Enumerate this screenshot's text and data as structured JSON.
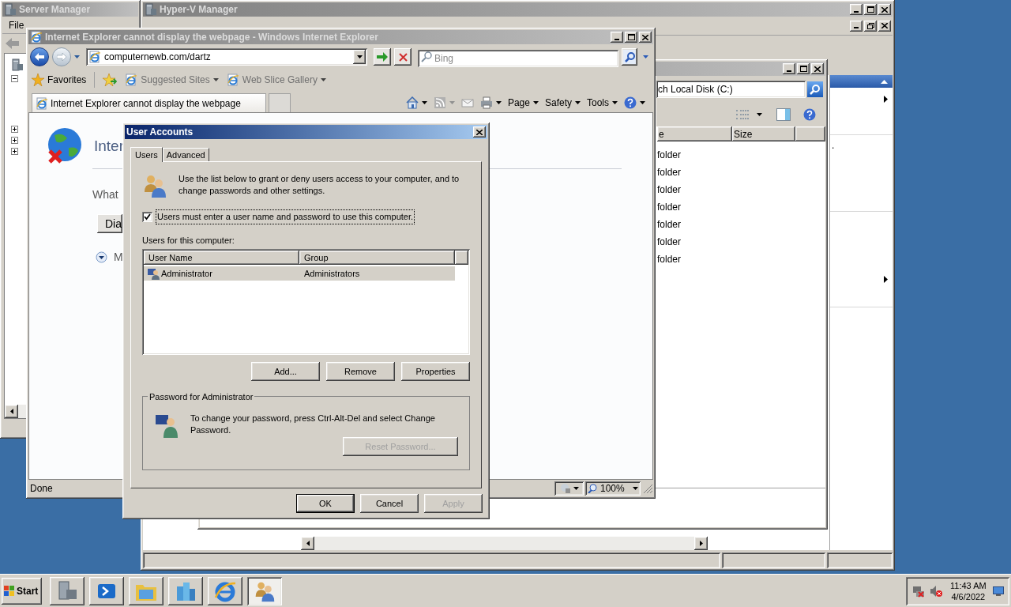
{
  "server_manager": {
    "title": "Server Manager",
    "active": false,
    "menu": [
      "File"
    ],
    "tree": [
      {
        "expanded": true
      },
      {
        "expanded": false
      },
      {
        "expanded": false
      },
      {
        "expanded": false
      }
    ]
  },
  "hyperv": {
    "title": "Hyper-V Manager",
    "active": false,
    "action_text": "."
  },
  "explorer": {
    "active": false,
    "search_text": "ch Local Disk (C:)",
    "columns": [
      "e",
      "Size"
    ],
    "rows": [
      "folder",
      "folder",
      "folder",
      "folder",
      "folder",
      "folder",
      "folder"
    ]
  },
  "ie": {
    "title": "Internet Explorer cannot display the webpage - Windows Internet Explorer",
    "active": false,
    "address": "computernewb.com/dartz",
    "search_placeholder": "Bing",
    "favorites": "Favorites",
    "links": [
      "Suggested Sites",
      "Web Slice Gallery"
    ],
    "tab": "Internet Explorer cannot display the webpage",
    "commands": [
      "Page",
      "Safety",
      "Tools"
    ],
    "page": {
      "heading": "Inter",
      "question": "What",
      "button": "Dia",
      "more": "M"
    },
    "status": "Done",
    "zoom": "100%"
  },
  "dialog": {
    "title": "User Accounts",
    "active": true,
    "tabs": [
      {
        "label": "Users",
        "selected": true
      },
      {
        "label": "Advanced",
        "selected": false
      }
    ],
    "intro": "Use the list below to grant or deny users access to your computer, and to change passwords and other settings.",
    "checkbox": {
      "label": "Users must enter a user name and password to use this computer.",
      "checked": true
    },
    "list_label": "Users for this computer:",
    "columns": [
      "User Name",
      "Group"
    ],
    "users": [
      {
        "name": "Administrator",
        "group": "Administrators",
        "selected": true
      }
    ],
    "buttons": [
      {
        "label": "Add...",
        "disabled": false
      },
      {
        "label": "Remove",
        "disabled": false
      },
      {
        "label": "Properties",
        "disabled": false
      }
    ],
    "password": {
      "title": "Password for Administrator",
      "text": "To change your password, press Ctrl-Alt-Del and select Change Password.",
      "button": {
        "label": "Reset Password...",
        "disabled": true
      }
    },
    "footer": [
      {
        "label": "OK",
        "disabled": false,
        "default": true
      },
      {
        "label": "Cancel",
        "disabled": false,
        "default": false
      },
      {
        "label": "Apply",
        "disabled": true,
        "default": false
      }
    ]
  },
  "taskbar": {
    "start": "Start",
    "items": [
      {
        "selected": false
      },
      {
        "selected": false
      },
      {
        "selected": false
      },
      {
        "selected": false
      },
      {
        "selected": false
      },
      {
        "selected": true
      }
    ],
    "time": "11:43 AM",
    "date": "4/6/2022"
  }
}
